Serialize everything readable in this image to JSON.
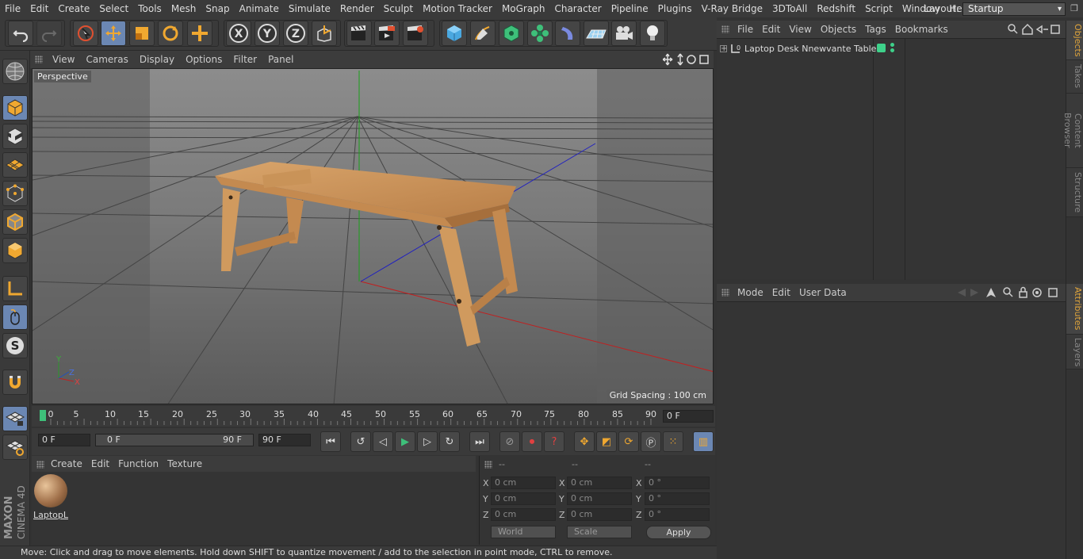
{
  "menubar": {
    "items": [
      "File",
      "Edit",
      "Create",
      "Select",
      "Tools",
      "Mesh",
      "Snap",
      "Animate",
      "Simulate",
      "Render",
      "Sculpt",
      "Motion Tracker",
      "MoGraph",
      "Character",
      "Pipeline",
      "Plugins",
      "V-Ray Bridge",
      "3DToAll",
      "Redshift",
      "Script",
      "Window",
      "Help"
    ],
    "layout_label": "Layout:",
    "layout_value": "Startup"
  },
  "viewport": {
    "menus": [
      "View",
      "Cameras",
      "Display",
      "Options",
      "Filter",
      "Panel"
    ],
    "view_name": "Perspective",
    "grid_spacing": "Grid Spacing : 100 cm",
    "axis_y": "Y",
    "axis_z": "Z",
    "axis_x": "X"
  },
  "timeline": {
    "ticks": [
      "0",
      "5",
      "10",
      "15",
      "20",
      "25",
      "30",
      "35",
      "40",
      "45",
      "50",
      "55",
      "60",
      "65",
      "70",
      "75",
      "80",
      "85",
      "90"
    ],
    "current_frame": "0 F"
  },
  "transport": {
    "start_frame": "0 F",
    "range_start": "0 F",
    "range_end": "90 F",
    "end_frame": "90 F"
  },
  "materials": {
    "menus": [
      "Create",
      "Edit",
      "Function",
      "Texture"
    ],
    "item_name": "LaptopL"
  },
  "coords": {
    "headers": [
      "--",
      "--",
      "--"
    ],
    "rows": [
      {
        "axis": "X",
        "pos": "0 cm",
        "size_axis": "X",
        "size": "0 cm",
        "rot_axis": "X",
        "rot": "0 °"
      },
      {
        "axis": "Y",
        "pos": "0 cm",
        "size_axis": "Y",
        "size": "0 cm",
        "rot_axis": "Y",
        "rot": "0 °"
      },
      {
        "axis": "Z",
        "pos": "0 cm",
        "size_axis": "Z",
        "size": "0 cm",
        "rot_axis": "Z",
        "rot": "0 °"
      }
    ],
    "space": "World",
    "mode": "Scale",
    "apply": "Apply"
  },
  "status": "Move: Click and drag to move elements. Hold down SHIFT to quantize movement / add to the selection in point mode, CTRL to remove.",
  "objects": {
    "menus": [
      "File",
      "Edit",
      "View",
      "Objects",
      "Tags",
      "Bookmarks"
    ],
    "item_name": "Laptop Desk Nnewvante Table"
  },
  "attributes": {
    "menus": [
      "Mode",
      "Edit",
      "User Data"
    ]
  },
  "right_tabs": [
    "Objects",
    "Takes",
    "Content Browser",
    "Structure",
    "Attributes",
    "Layers"
  ],
  "logo": {
    "line1": "MAXON",
    "line2": "CINEMA 4D"
  },
  "colors": {
    "accent": "#6b87b3",
    "tab_active": "#e0a53b",
    "green_tag": "#3ed18a"
  }
}
